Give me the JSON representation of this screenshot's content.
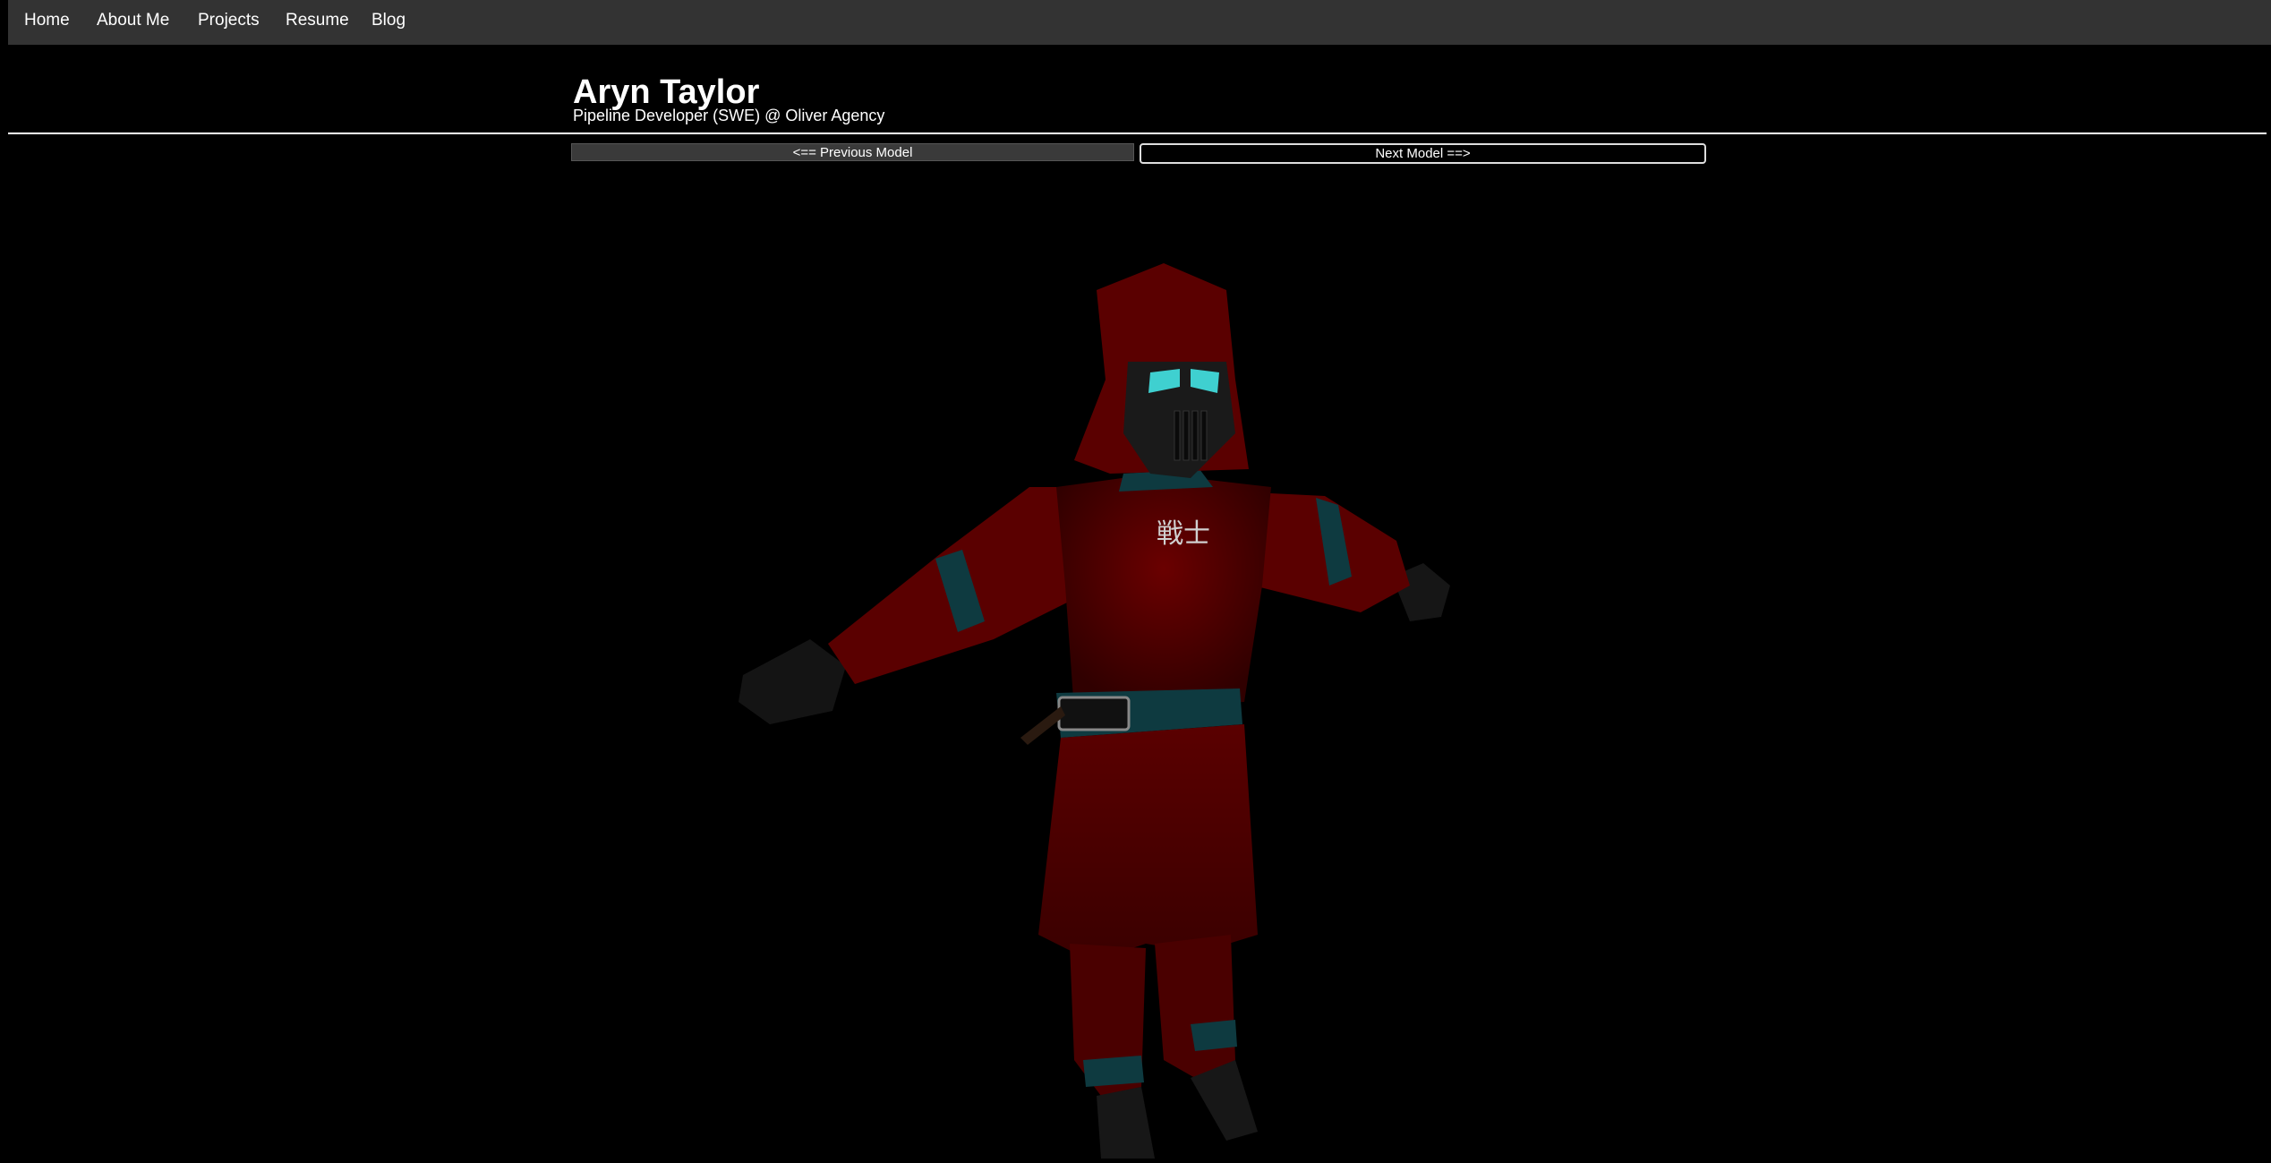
{
  "nav": {
    "items": [
      {
        "label": "Home"
      },
      {
        "label": "About Me"
      },
      {
        "label": "Projects"
      },
      {
        "label": "Resume"
      },
      {
        "label": "Blog"
      }
    ]
  },
  "header": {
    "name": "Aryn Taylor",
    "subtitle": "Pipeline Developer (SWE) @ Oliver Agency"
  },
  "model_nav": {
    "previous_label": "<== Previous Model",
    "next_label": "Next Model ==>"
  },
  "model": {
    "chest_text": "戦士",
    "colors": {
      "suit": "#5a0000",
      "trim": "#0e3a40",
      "visor": "#3fd0d0",
      "mask": "#1a1a1a",
      "background": "#000000"
    }
  }
}
